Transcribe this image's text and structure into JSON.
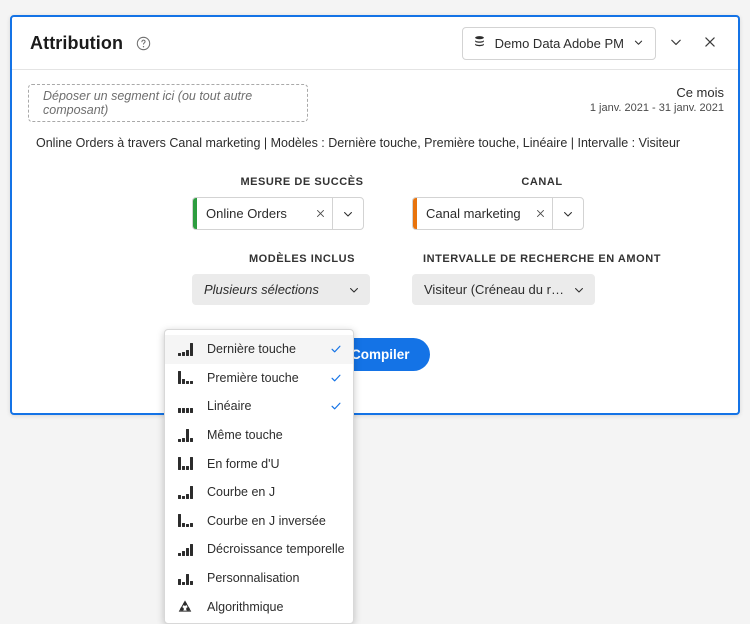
{
  "header": {
    "title": "Attribution",
    "help_icon": "help-circle-icon",
    "report_suite": "Demo Data Adobe PM",
    "suite_icon": "data-stack-icon",
    "collapse_icon": "chevron-down-icon",
    "close_icon": "close-icon"
  },
  "segment_dropzone": {
    "placeholder": "Déposer un segment ici (ou tout autre composant)"
  },
  "date_range": {
    "title": "Ce mois",
    "subtitle": "1 janv. 2021 - 31 janv. 2021"
  },
  "description": "Online Orders à travers Canal marketing | Modèles : Dernière touche, Première touche, Linéaire | Intervalle : Visiteur",
  "fields": {
    "success_metric": {
      "label": "MESURE DE SUCCÈS",
      "value": "Online Orders",
      "accent_color": "#2d9d3f",
      "clear_icon": "close-icon",
      "chevron_icon": "chevron-down-icon"
    },
    "channel": {
      "label": "CANAL",
      "value": "Canal marketing",
      "accent_color": "#e8730c",
      "clear_icon": "close-icon",
      "chevron_icon": "chevron-down-icon"
    },
    "models_included": {
      "label": "MODÈLES INCLUS",
      "value": "Plusieurs sélections",
      "chevron_icon": "chevron-down-icon"
    },
    "lookback_window": {
      "label": "INTERVALLE DE RECHERCHE EN AMONT",
      "value": "Visiteur (Créneau du rapp...",
      "chevron_icon": "chevron-down-icon"
    }
  },
  "compile_button": {
    "label": "Compiler",
    "color": "#1473e6"
  },
  "models_menu": {
    "check_color": "#1473e6",
    "items": [
      {
        "label": "Dernière touche",
        "icon": "last-touch-icon",
        "checked": true,
        "highlighted": true,
        "bars": [
          3,
          4,
          6,
          13
        ]
      },
      {
        "label": "Première touche",
        "icon": "first-touch-icon",
        "checked": true,
        "highlighted": false,
        "bars": [
          13,
          5,
          3,
          3
        ]
      },
      {
        "label": "Linéaire",
        "icon": "linear-icon",
        "checked": true,
        "highlighted": false,
        "bars": [
          5,
          5,
          5,
          5
        ]
      },
      {
        "label": "Même touche",
        "icon": "same-touch-icon",
        "checked": false,
        "highlighted": false,
        "bars": [
          3,
          4,
          13,
          4
        ]
      },
      {
        "label": "En forme d'U",
        "icon": "u-shaped-icon",
        "checked": false,
        "highlighted": false,
        "bars": [
          13,
          4,
          4,
          13
        ]
      },
      {
        "label": "Courbe en J",
        "icon": "j-curve-icon",
        "checked": false,
        "highlighted": false,
        "bars": [
          4,
          3,
          5,
          13
        ]
      },
      {
        "label": "Courbe en J inversée",
        "icon": "inverse-j-curve-icon",
        "checked": false,
        "highlighted": false,
        "bars": [
          13,
          4,
          3,
          4
        ]
      },
      {
        "label": "Décroissance temporelle",
        "icon": "time-decay-icon",
        "checked": false,
        "highlighted": false,
        "bars": [
          3,
          5,
          8,
          12
        ]
      },
      {
        "label": "Personnalisation",
        "icon": "custom-icon",
        "checked": false,
        "highlighted": false,
        "bars": [
          6,
          3,
          11,
          4
        ]
      },
      {
        "label": "Algorithmique",
        "icon": "algorithmic-icon",
        "checked": false,
        "highlighted": false,
        "bars": []
      }
    ]
  }
}
